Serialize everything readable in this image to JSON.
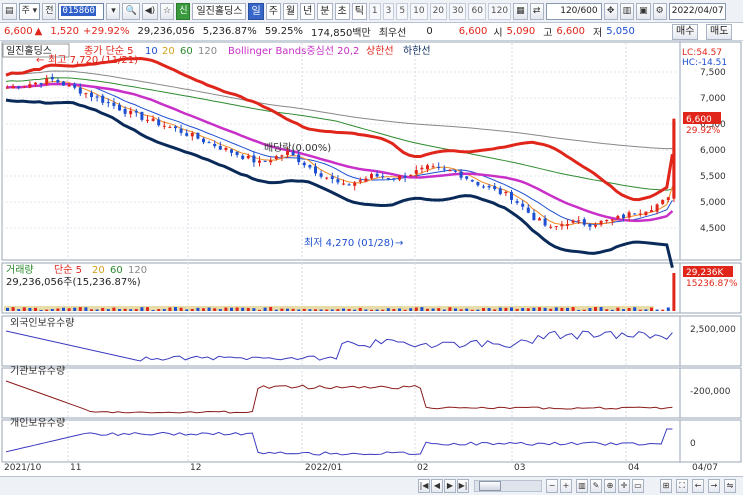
{
  "toolbar": {
    "market_label": "주",
    "prev_label": "전",
    "stock_code": "015860",
    "stock_name": "일진홀딩스",
    "period_tabs": [
      "일",
      "주",
      "월",
      "년",
      "분",
      "초",
      "틱"
    ],
    "active_period": "일",
    "intervals": [
      "1",
      "3",
      "5",
      "10",
      "20",
      "30",
      "60",
      "120"
    ],
    "count_display": "120/600",
    "date": "2022/04/07",
    "badge": "신"
  },
  "pricebar": {
    "price": "6,600",
    "change": "1,520",
    "change_pct": "+29.92%",
    "volume": "29,236,056",
    "volume_pct": "5,236.87%",
    "turnover_pct": "59.25%",
    "amount": "174,850백만",
    "priority_label": "최우선",
    "priority_value": "0",
    "ask": "6,600",
    "open_label": "시",
    "open": "5,090",
    "high_label": "고",
    "high": "6,600",
    "low_label": "저",
    "low": "5,050",
    "sell_button": "매수",
    "buy_button": "매도"
  },
  "price_panel": {
    "name_label": "일진홀딩스",
    "legend": [
      "종가 단순 5",
      "10",
      "20",
      "60",
      "120"
    ],
    "bb_label": "Bollinger Bands중심선 20,2",
    "bb_upper": "상한선",
    "bb_lower": "하한선",
    "high_note": "최고 7,720 (11/21)",
    "low_note": "최저 4,270 (01/28)",
    "dividend_note": "배당락(0.00%)",
    "lc": "LC:54.57",
    "hc": "HC:-14.51",
    "y_ticks": [
      "7,500",
      "7,000",
      "6,500",
      "6,000",
      "5,500",
      "5,000",
      "4,500"
    ],
    "current_price": "6,600",
    "current_pct": "29.92%"
  },
  "volume_panel": {
    "title": "거래량",
    "legend": [
      "단순 5",
      "20",
      "60",
      "120"
    ],
    "value_text": "29,236,056주(15,236.87%)",
    "tag_value": "29,236K",
    "tag_pct": "15236.87%"
  },
  "foreign_panel": {
    "title": "외국인보유수량",
    "y_tick": "2,500,000"
  },
  "inst_panel": {
    "title": "기관보유수량",
    "y_tick": "-200,000"
  },
  "indiv_panel": {
    "title": "개인보유수량",
    "y_tick": "0"
  },
  "x_axis": [
    "2021/10",
    "11",
    "12",
    "2022/01",
    "02",
    "03",
    "04",
    "04/07"
  ],
  "colors": {
    "up": "#e0261b",
    "down": "#1d4fd1",
    "ma5": "#f08a24",
    "ma20": "#c830c8",
    "ma60": "#2e8b2e",
    "ma120": "#888888",
    "bb_upper": "#e0261b",
    "bb_lower": "#0a2a5a",
    "foreign": "#3b3bc0",
    "inst": "#8b1a1a",
    "indiv": "#3b3bc0"
  }
}
